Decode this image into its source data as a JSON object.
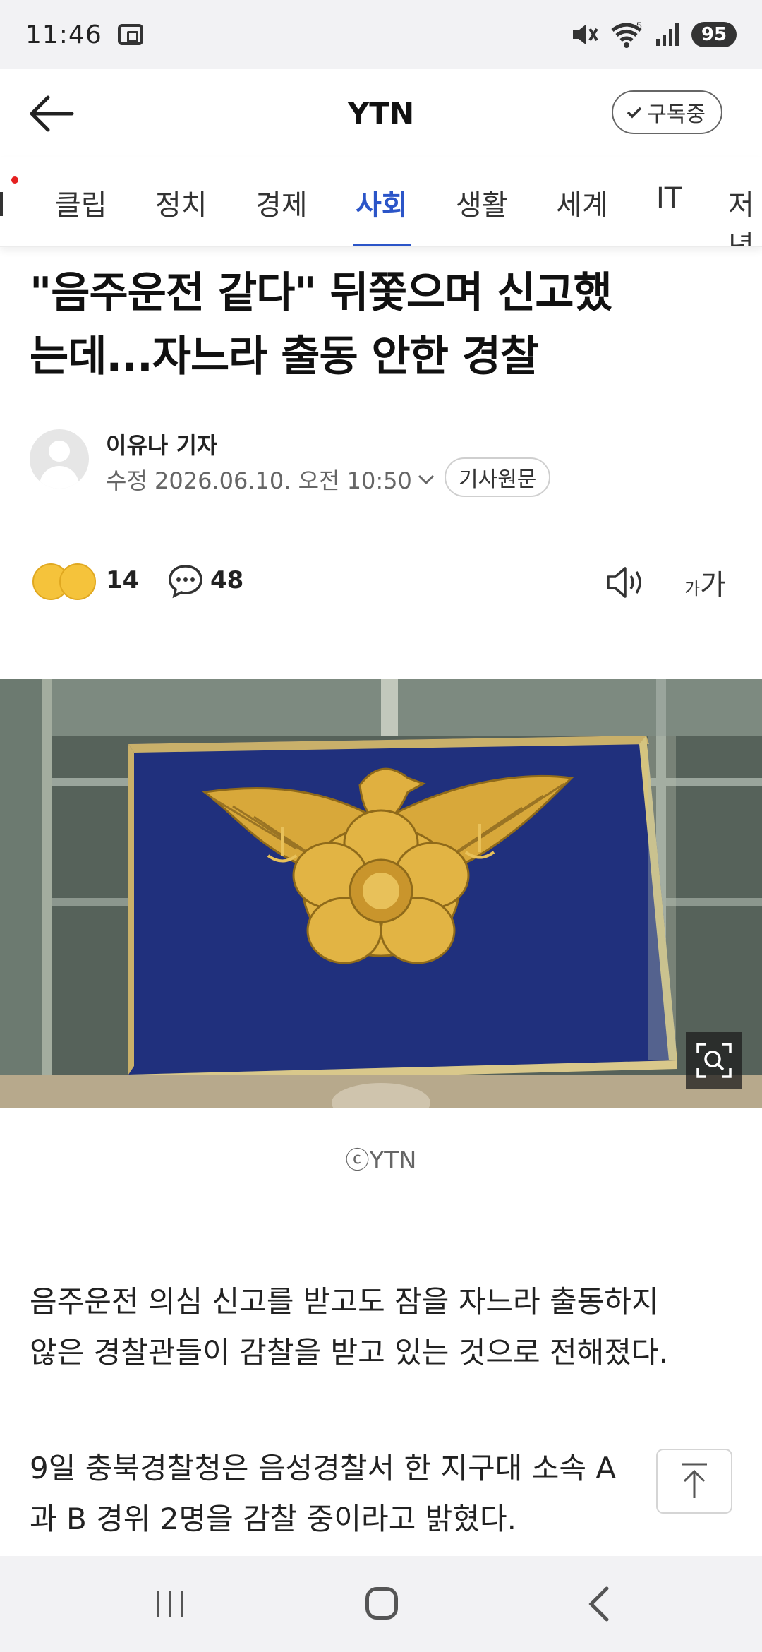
{
  "status_bar": {
    "time": "11:46",
    "battery": "95",
    "network": "5"
  },
  "header": {
    "title": "YTN",
    "subscribe_label": "구독중"
  },
  "tabs": [
    {
      "label": "클립",
      "active": false
    },
    {
      "label": "정치",
      "active": false
    },
    {
      "label": "경제",
      "active": false
    },
    {
      "label": "사회",
      "active": true
    },
    {
      "label": "생활",
      "active": false
    },
    {
      "label": "세계",
      "active": false
    },
    {
      "label": "IT",
      "active": false
    },
    {
      "label": "저녁",
      "active": false
    }
  ],
  "article": {
    "headline_line1": "\"음주운전 같다\" 뒤쫓으며 신고했",
    "headline_line2": "는데...자느라 출동 안한 경찰",
    "author": "이유나 기자",
    "edited": "수정 2026.06.10. 오전 10:50",
    "original_label": "기사원문",
    "reaction_count": "14",
    "comment_count": "48",
    "font_small": "가",
    "font_big": "가",
    "image_caption": "ⓒYTN",
    "paragraphs": [
      [
        "음주운전 의심 신고를 받고도 잠을 자느라 출동하지",
        "않은 경찰관들이 감찰을 받고 있는 것으로 전해졌다."
      ],
      [
        "9일 충북경찰청은 음성경찰서 한 지구대 소속 A",
        "과 B 경위 2명을 감찰 중이라고 밝혔다."
      ]
    ]
  },
  "colors": {
    "accent": "#2b55c8",
    "badge_dot": "#e52020",
    "status_bg": "#f2f2f4"
  }
}
